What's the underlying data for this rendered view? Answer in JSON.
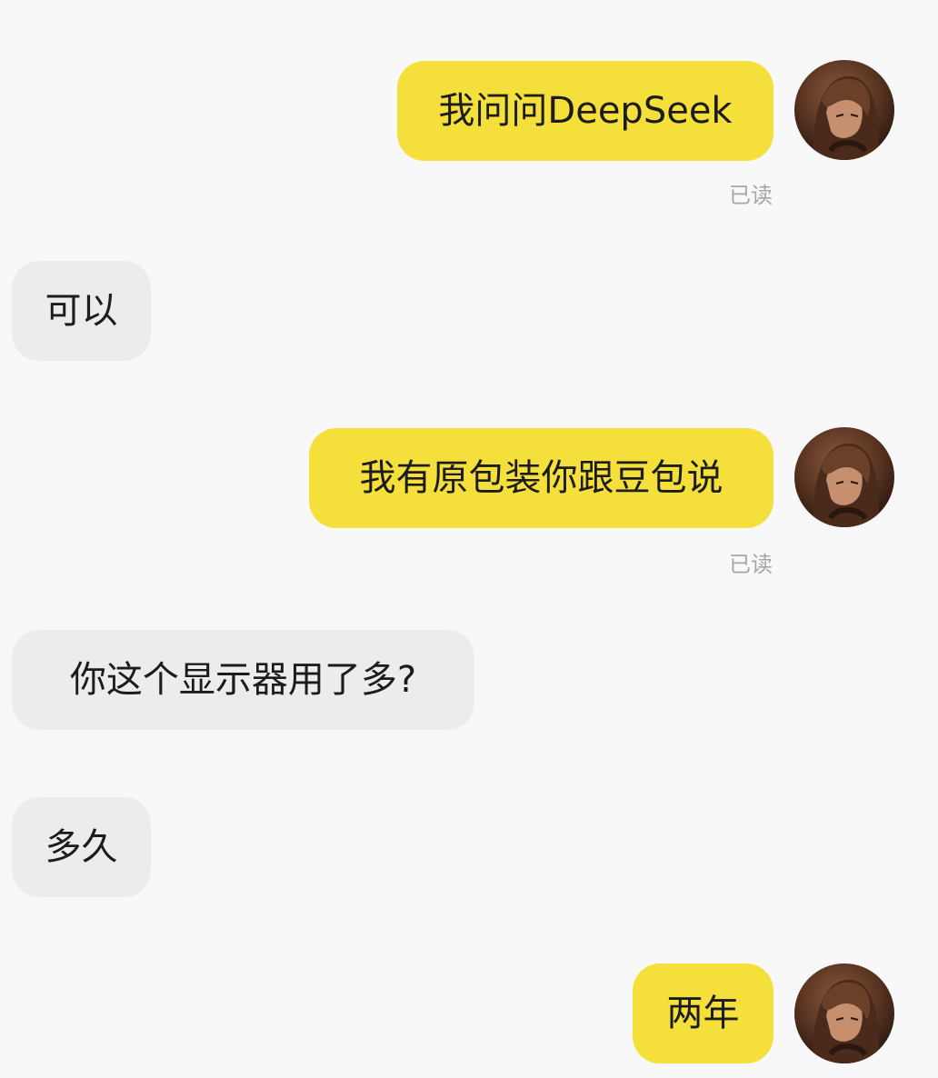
{
  "messages": [
    {
      "side": "out",
      "text": "我问问DeepSeek",
      "status": "已读"
    },
    {
      "side": "in",
      "text": "可以"
    },
    {
      "side": "out",
      "text": "我有原包装你跟豆包说",
      "status": "已读"
    },
    {
      "side": "in",
      "text": "你这个显示器用了多?"
    },
    {
      "side": "in",
      "text": "多久"
    },
    {
      "side": "out",
      "text": "两年"
    }
  ],
  "icons": {
    "avatar": "user-avatar-icon"
  },
  "colors": {
    "outgoing_bubble": "#f5df3a",
    "incoming_bubble": "#ececec",
    "background": "#f8f8f8",
    "read_status": "#a6a6a6"
  }
}
